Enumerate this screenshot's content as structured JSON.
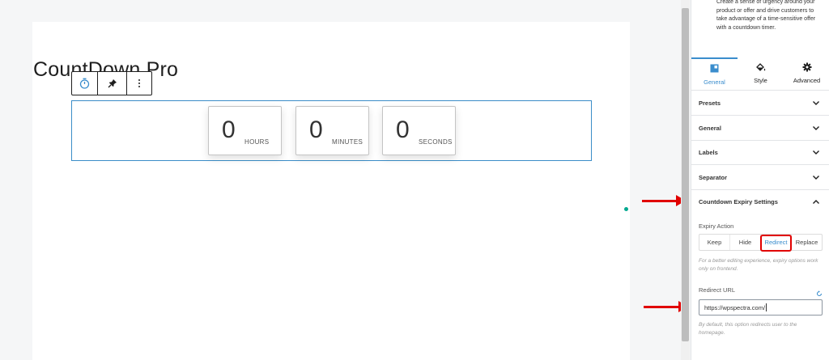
{
  "canvas": {
    "title": "CountDown Pro",
    "countdown": [
      {
        "value": "0",
        "label": "HOURS"
      },
      {
        "value": "0",
        "label": "MINUTES"
      },
      {
        "value": "0",
        "label": "SECONDS"
      }
    ]
  },
  "toolbar": {
    "icons": [
      "timer-icon",
      "pin-icon",
      "more-options-icon"
    ]
  },
  "sidebar": {
    "description": "Create a sense of urgency around your product or offer and drive customers to take advantage of a time-sensitive offer with a countdown timer.",
    "tabs": [
      {
        "label": "General",
        "icon": "general-icon",
        "active": true
      },
      {
        "label": "Style",
        "icon": "style-icon",
        "active": false
      },
      {
        "label": "Advanced",
        "icon": "gear-icon",
        "active": false
      }
    ],
    "panels": [
      {
        "label": "Presets"
      },
      {
        "label": "General"
      },
      {
        "label": "Labels"
      },
      {
        "label": "Separator"
      },
      {
        "label": "Countdown Expiry Settings",
        "open": true
      }
    ],
    "expiry": {
      "label": "Expiry Action",
      "options": [
        "Keep",
        "Hide",
        "Redirect",
        "Replace"
      ],
      "selected": "Redirect",
      "help": "For a better editing experience, expiry options work only on frontend."
    },
    "redirect": {
      "label": "Redirect URL",
      "value": "https://wpspectra.com/",
      "help": "By default, this option redirects user to the homepage."
    }
  },
  "colors": {
    "accent": "#3a8dcd",
    "annotation": "#e10000",
    "block_border": "#3b8dc8"
  }
}
